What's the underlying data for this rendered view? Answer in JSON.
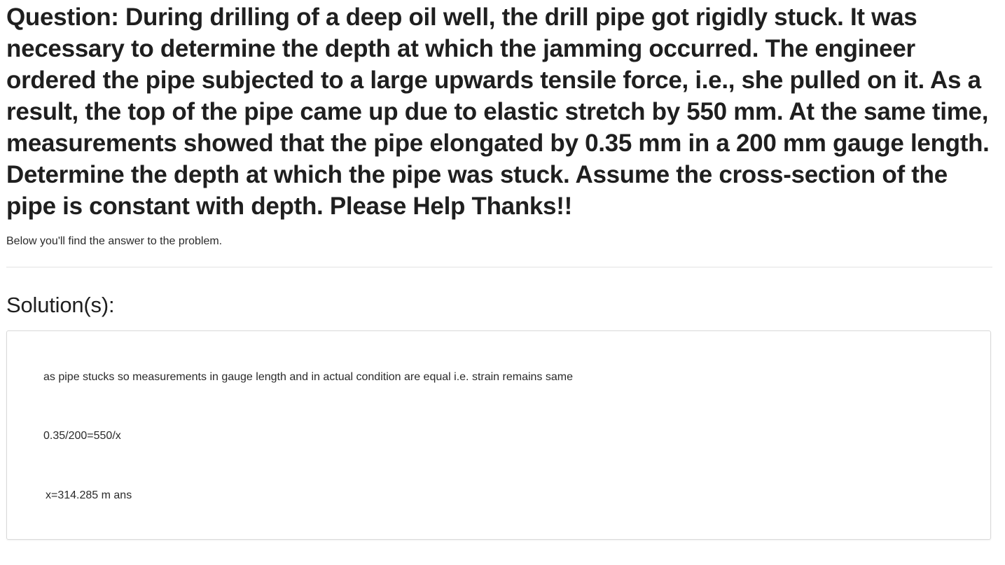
{
  "question": {
    "text": "Question: During drilling of a deep oil well, the drill pipe got rigidly stuck. It was necessary to determine the depth at which the jamming occurred. The engineer ordered the pipe subjected to a large upwards tensile force, i.e., she pulled on it. As a result, the top of the pipe came up due to elastic stretch by 550 mm. At the same time, measurements showed that the pipe elongated by 0.35 mm in a 200 mm gauge length. Determine the depth at which the pipe was stuck. Assume the cross-section of the pipe is constant with depth. Please Help Thanks!!"
  },
  "intro": {
    "text": "Below you'll find the answer to the problem."
  },
  "solution": {
    "heading": "Solution(s):",
    "lines": [
      "as pipe stucks so measurements in gauge length and in actual condition are equal i.e. strain remains same",
      "0.35/200=550/x",
      "x=314.285 m ans"
    ]
  }
}
